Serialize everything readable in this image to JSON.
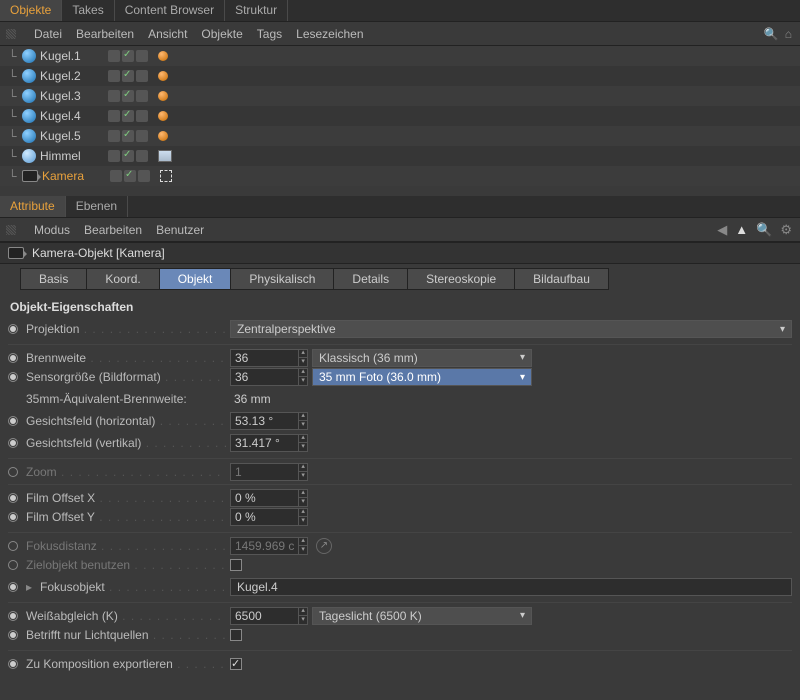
{
  "topTabs": {
    "items": [
      "Objekte",
      "Takes",
      "Content Browser",
      "Struktur"
    ],
    "active": 0
  },
  "objMenu": [
    "Datei",
    "Bearbeiten",
    "Ansicht",
    "Objekte",
    "Tags",
    "Lesezeichen"
  ],
  "tree": [
    {
      "name": "Kugel.1",
      "type": "sphere",
      "hasMat": true
    },
    {
      "name": "Kugel.2",
      "type": "sphere",
      "hasMat": true
    },
    {
      "name": "Kugel.3",
      "type": "sphere",
      "hasMat": true
    },
    {
      "name": "Kugel.4",
      "type": "sphere",
      "hasMat": true
    },
    {
      "name": "Kugel.5",
      "type": "sphere",
      "hasMat": true
    },
    {
      "name": "Himmel",
      "type": "sky",
      "hasImg": true
    },
    {
      "name": "Kamera",
      "type": "camera",
      "active": true,
      "hasComp": true
    }
  ],
  "lowerTabs": {
    "items": [
      "Attribute",
      "Ebenen"
    ],
    "active": 0
  },
  "attrMenu": [
    "Modus",
    "Bearbeiten",
    "Benutzer"
  ],
  "attrHeader": "Kamera-Objekt [Kamera]",
  "subTabs": {
    "items": [
      "Basis",
      "Koord.",
      "Objekt",
      "Physikalisch",
      "Details",
      "Stereoskopie",
      "Bildaufbau"
    ],
    "active": 2
  },
  "sectionTitle": "Objekt-Eigenschaften",
  "props": {
    "projektion": {
      "label": "Projektion",
      "value": "Zentralperspektive"
    },
    "brennweite": {
      "label": "Brennweite",
      "value": "36",
      "preset": "Klassisch (36 mm)"
    },
    "sensor": {
      "label": "Sensorgröße (Bildformat)",
      "value": "36",
      "preset": "35 mm Foto (36.0 mm)"
    },
    "equiv": {
      "label": "35mm-Äquivalent-Brennweite:",
      "value": "36 mm"
    },
    "fovh": {
      "label": "Gesichtsfeld (horizontal)",
      "value": "53.13 °"
    },
    "fovv": {
      "label": "Gesichtsfeld (vertikal)",
      "value": "31.417 °"
    },
    "zoom": {
      "label": "Zoom",
      "value": "1"
    },
    "offx": {
      "label": "Film Offset X",
      "value": "0 %"
    },
    "offy": {
      "label": "Film Offset Y",
      "value": "0 %"
    },
    "fokusdist": {
      "label": "Fokusdistanz",
      "value": "1459.969 c"
    },
    "zielobj": {
      "label": "Zielobjekt benutzen"
    },
    "fokusobj": {
      "label": "Fokusobjekt",
      "value": "Kugel.4"
    },
    "wb": {
      "label": "Weißabgleich (K)",
      "value": "6500",
      "preset": "Tageslicht (6500 K)"
    },
    "lights": {
      "label": "Betrifft nur Lichtquellen"
    },
    "export": {
      "label": "Zu Komposition exportieren"
    }
  }
}
